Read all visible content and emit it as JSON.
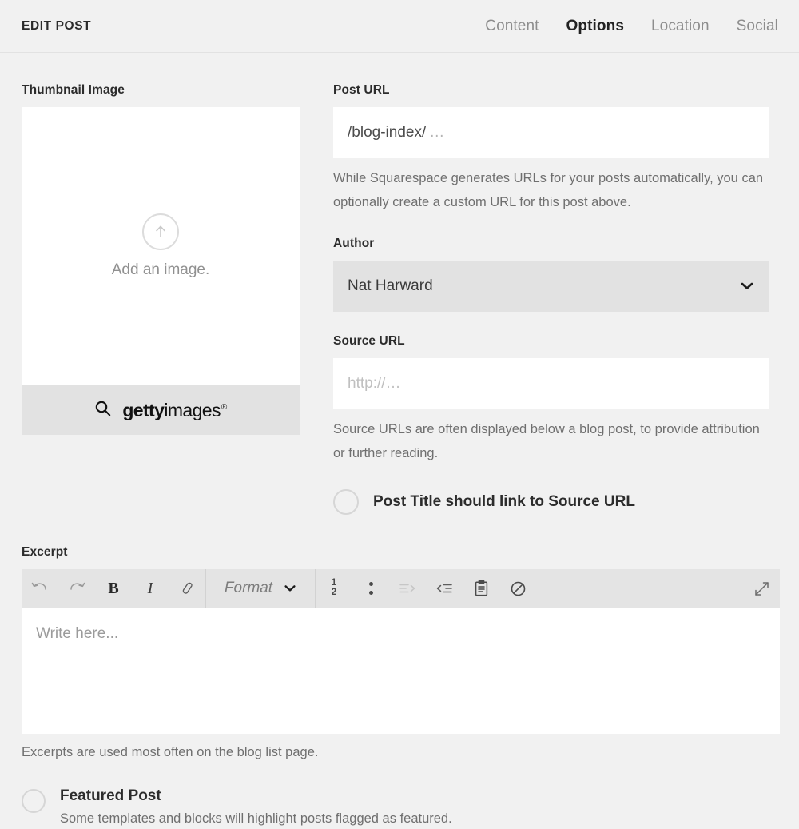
{
  "header": {
    "title": "EDIT POST",
    "tabs": [
      {
        "label": "Content",
        "active": false
      },
      {
        "label": "Options",
        "active": true
      },
      {
        "label": "Location",
        "active": false
      },
      {
        "label": "Social",
        "active": false
      }
    ]
  },
  "thumbnail": {
    "label": "Thumbnail Image",
    "upload_icon": "upload-arrow-icon",
    "placeholder_text": "Add an image.",
    "getty": {
      "search_icon": "search-icon",
      "brand_bold": "getty",
      "brand_regular": "images",
      "registered_mark": "®"
    }
  },
  "post_url": {
    "label": "Post URL",
    "value": "/blog-index/",
    "placeholder": "…",
    "helper": "While Squarespace generates URLs for your posts automatically, you can optionally create a custom URL for this post above."
  },
  "author": {
    "label": "Author",
    "value": "Nat Harward",
    "caret_icon": "chevron-down-icon"
  },
  "source_url": {
    "label": "Source URL",
    "value": "",
    "placeholder": "http://…",
    "helper": "Source URLs are often displayed below a blog post, to provide attribution or further reading.",
    "toggle": {
      "label": "Post Title should link to Source URL",
      "checked": false
    }
  },
  "excerpt": {
    "label": "Excerpt",
    "placeholder": "Write here...",
    "helper": "Excerpts are used most often on the blog list page.",
    "toolbar": {
      "undo": "undo-icon",
      "redo": "redo-icon",
      "bold": "B",
      "italic": "I",
      "link": "link-icon",
      "format_label": "Format",
      "format_caret": "chevron-down-icon",
      "ordered_list_top": "1",
      "ordered_list_bottom": "2",
      "unordered_list": "bullet-list-icon",
      "indent": "indent-icon",
      "outdent": "outdent-icon",
      "paste": "clipboard-icon",
      "clear_format": "no-format-icon",
      "expand": "expand-icon"
    }
  },
  "featured": {
    "title": "Featured Post",
    "description": "Some templates and blocks will highlight posts flagged as featured.",
    "checked": false
  },
  "colors": {
    "background": "#f1f1f1",
    "input_background": "#ffffff",
    "select_background": "#e2e2e2",
    "toolbar_background": "#e4e4e4",
    "text_primary": "#2c2c2c",
    "text_muted": "#6f6f6f",
    "placeholder": "#b4b4b4"
  }
}
